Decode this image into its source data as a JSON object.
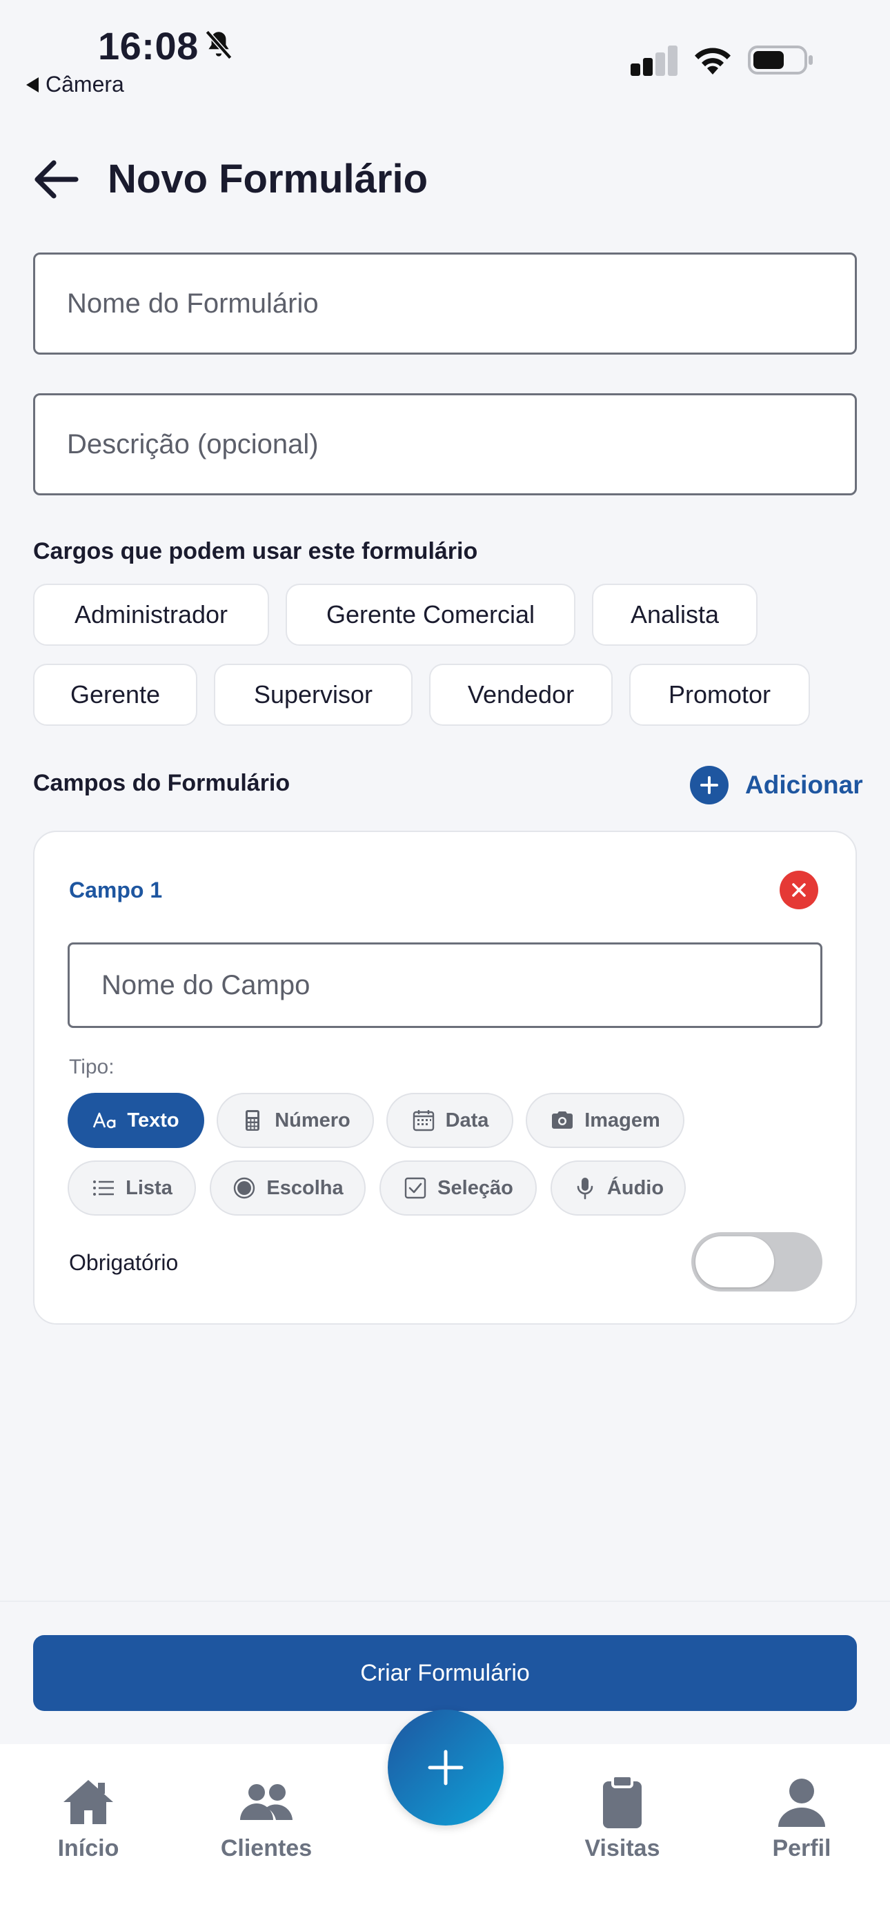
{
  "status_bar": {
    "time": "16:08",
    "back_app": "Câmera",
    "icons": [
      "bell-slash-icon",
      "cellular-signal-icon",
      "wifi-icon",
      "battery-icon"
    ]
  },
  "header": {
    "back_icon": "arrow-left-icon",
    "title": "Novo Formulário"
  },
  "form": {
    "name_placeholder": "Nome do Formulário",
    "description_placeholder": "Descrição (opcional)"
  },
  "roles": {
    "label": "Cargos que podem usar este formulário",
    "items": [
      "Administrador",
      "Gerente Comercial",
      "Analista",
      "Gerente",
      "Supervisor",
      "Vendedor",
      "Promotor"
    ]
  },
  "fields": {
    "label": "Campos do Formulário",
    "add_label": "Adicionar",
    "items": [
      {
        "title": "Campo 1",
        "name_placeholder": "Nome do Campo",
        "type_label": "Tipo:",
        "types": [
          {
            "label": "Texto",
            "icon": "text-format-icon",
            "active": true
          },
          {
            "label": "Número",
            "icon": "calculator-icon",
            "active": false
          },
          {
            "label": "Data",
            "icon": "calendar-icon",
            "active": false
          },
          {
            "label": "Imagem",
            "icon": "camera-icon",
            "active": false
          },
          {
            "label": "Lista",
            "icon": "list-icon",
            "active": false
          },
          {
            "label": "Escolha",
            "icon": "radio-icon",
            "active": false
          },
          {
            "label": "Seleção",
            "icon": "checkbox-icon",
            "active": false
          },
          {
            "label": "Áudio",
            "icon": "microphone-icon",
            "active": false
          }
        ],
        "required_label": "Obrigatório",
        "required": false
      }
    ]
  },
  "actions": {
    "create_label": "Criar Formulário"
  },
  "nav": {
    "items": [
      {
        "label": "Início",
        "icon": "home-icon"
      },
      {
        "label": "Clientes",
        "icon": "users-icon"
      },
      {
        "label": "Visitas",
        "icon": "clipboard-icon"
      },
      {
        "label": "Perfil",
        "icon": "user-icon"
      }
    ],
    "fab_icon": "plus-icon"
  },
  "colors": {
    "primary": "#1e56a0",
    "danger": "#e53935",
    "background": "#f5f6f9"
  }
}
